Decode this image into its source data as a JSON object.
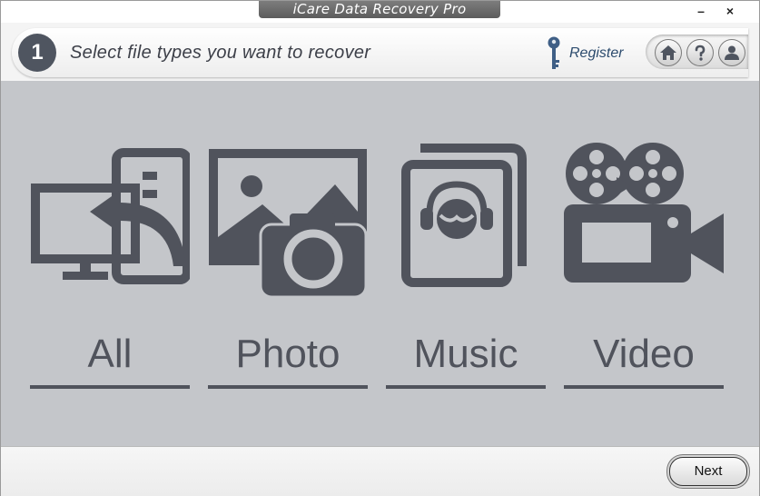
{
  "window": {
    "title": "iCare Data Recovery Pro",
    "minimize_label": "–",
    "close_label": "×"
  },
  "header": {
    "step_number": "1",
    "step_title": "Select file types you want to recover",
    "register_label": "Register",
    "toolbar": [
      "home-icon",
      "help-icon",
      "user-icon"
    ]
  },
  "file_types": [
    {
      "label": "All",
      "icon": "all-files-icon"
    },
    {
      "label": "Photo",
      "icon": "photo-icon"
    },
    {
      "label": "Music",
      "icon": "music-icon"
    },
    {
      "label": "Video",
      "icon": "video-icon"
    }
  ],
  "footer": {
    "next_label": "Next"
  },
  "colors": {
    "icon": "#50535c",
    "content_bg": "#c4c6ca",
    "step_circle": "#4f5560",
    "link": "#2d4c6e"
  }
}
